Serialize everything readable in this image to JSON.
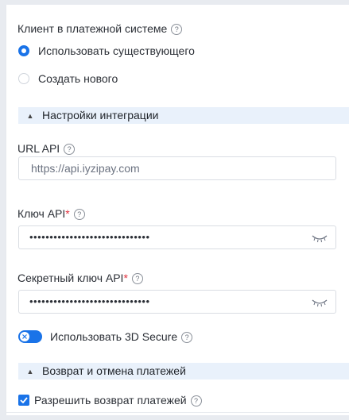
{
  "client": {
    "label": "Клиент в платежной системе",
    "options": [
      {
        "label": "Использовать существующего",
        "selected": true
      },
      {
        "label": "Создать нового",
        "selected": false
      }
    ]
  },
  "integration": {
    "section_title": "Настройки интеграции",
    "url": {
      "label": "URL API",
      "value": "https://api.iyzipay.com"
    },
    "api_key": {
      "label": "Ключ API",
      "required_mark": "*",
      "value": "••••••••••••••••••••••••••••••"
    },
    "secret_key": {
      "label": "Секретный ключ API",
      "required_mark": "*",
      "value": "••••••••••••••••••••••••••••••"
    },
    "secure3d": {
      "label": "Использовать 3D Secure",
      "enabled": true
    }
  },
  "refunds": {
    "section_title": "Возврат и отмена платежей",
    "allow_refund": {
      "label": "Разрешить возврат платежей",
      "checked": true
    }
  },
  "icons": {
    "help": "?",
    "collapse": "chevron-up-icon",
    "eye": "eye-closed-icon"
  },
  "colors": {
    "accent": "#1a73e8",
    "section_bg": "#e9f1fb",
    "required": "#e0303d"
  }
}
